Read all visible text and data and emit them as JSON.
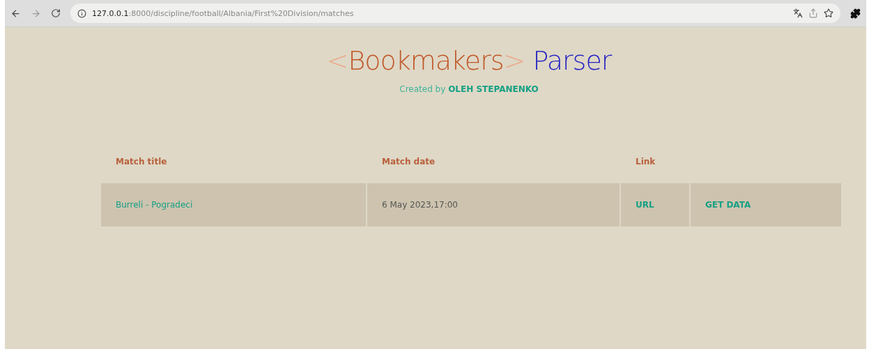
{
  "browser": {
    "url_host": "127.0.0.1",
    "url_path": ":8000/discipline/football/Albania/First%20Division/matches"
  },
  "header": {
    "bracket_open": "<",
    "brand": "Bookmakers",
    "bracket_close": ">",
    "title": "Parser",
    "credit_prefix": "Created by",
    "credit_name": "OLEH STEPANENKO"
  },
  "table": {
    "columns": [
      "Match title",
      "Match date",
      "Link"
    ],
    "rows": [
      {
        "title": "Burreli - Pogradeci",
        "date": "6 May 2023,17:00",
        "link": "URL",
        "action": "GET DATA"
      }
    ]
  }
}
